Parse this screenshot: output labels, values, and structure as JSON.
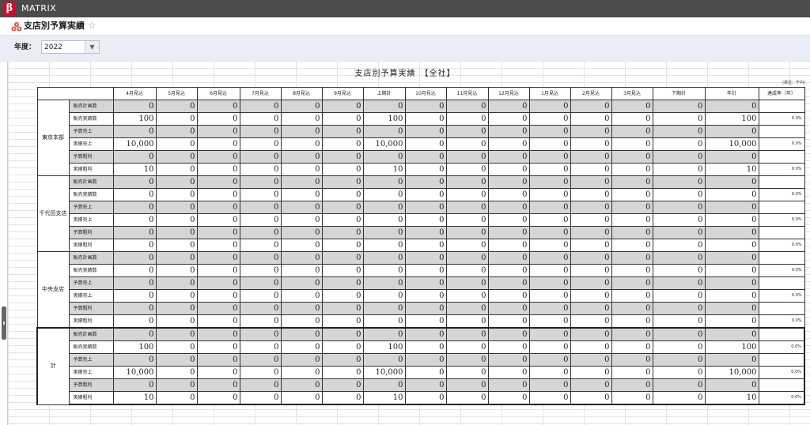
{
  "app": {
    "name": "MATRIX",
    "logo": "β"
  },
  "page": {
    "title": "支店別予算実績",
    "star": "☆",
    "icon": "tricolor-circles-icon"
  },
  "filter": {
    "year_label": "年度：",
    "year_value": "2022"
  },
  "report": {
    "title": "支店別予算実績　【全社】",
    "unit": "(単位：千円)",
    "columns": [
      "4月見込",
      "5月見込",
      "6月見込",
      "7月見込",
      "8月見込",
      "9月見込",
      "上期計",
      "10月見込",
      "11月見込",
      "12月見込",
      "1月見込",
      "2月見込",
      "3月見込",
      "下期計",
      "年計",
      "達成率（年）"
    ],
    "row_labels": [
      "販売計画数",
      "販売実績数",
      "予算売上",
      "実績売上",
      "予算粗利",
      "実績粗利"
    ],
    "groups": [
      {
        "name": "東京本部",
        "rows": [
          [
            "0",
            "0",
            "0",
            "0",
            "0",
            "0",
            "0",
            "0",
            "0",
            "0",
            "0",
            "0",
            "0",
            "0",
            "0",
            ""
          ],
          [
            "100",
            "0",
            "0",
            "0",
            "0",
            "0",
            "100",
            "0",
            "0",
            "0",
            "0",
            "0",
            "0",
            "0",
            "100",
            "0.0%"
          ],
          [
            "0",
            "0",
            "0",
            "0",
            "0",
            "0",
            "0",
            "0",
            "0",
            "0",
            "0",
            "0",
            "0",
            "0",
            "0",
            ""
          ],
          [
            "10,000",
            "0",
            "0",
            "0",
            "0",
            "0",
            "10,000",
            "0",
            "0",
            "0",
            "0",
            "0",
            "0",
            "0",
            "10,000",
            "0.0%"
          ],
          [
            "0",
            "0",
            "0",
            "0",
            "0",
            "0",
            "0",
            "0",
            "0",
            "0",
            "0",
            "0",
            "0",
            "0",
            "0",
            ""
          ],
          [
            "10",
            "0",
            "0",
            "0",
            "0",
            "0",
            "10",
            "0",
            "0",
            "0",
            "0",
            "0",
            "0",
            "0",
            "10",
            "0.0%"
          ]
        ]
      },
      {
        "name": "千代田支店",
        "rows": [
          [
            "0",
            "0",
            "0",
            "0",
            "0",
            "0",
            "0",
            "0",
            "0",
            "0",
            "0",
            "0",
            "0",
            "0",
            "0",
            ""
          ],
          [
            "0",
            "0",
            "0",
            "0",
            "0",
            "0",
            "0",
            "0",
            "0",
            "0",
            "0",
            "0",
            "0",
            "0",
            "0",
            "0.0%"
          ],
          [
            "0",
            "0",
            "0",
            "0",
            "0",
            "0",
            "0",
            "0",
            "0",
            "0",
            "0",
            "0",
            "0",
            "0",
            "0",
            ""
          ],
          [
            "0",
            "0",
            "0",
            "0",
            "0",
            "0",
            "0",
            "0",
            "0",
            "0",
            "0",
            "0",
            "0",
            "0",
            "0",
            "0.0%"
          ],
          [
            "0",
            "0",
            "0",
            "0",
            "0",
            "0",
            "0",
            "0",
            "0",
            "0",
            "0",
            "0",
            "0",
            "0",
            "0",
            ""
          ],
          [
            "0",
            "0",
            "0",
            "0",
            "0",
            "0",
            "0",
            "0",
            "0",
            "0",
            "0",
            "0",
            "0",
            "0",
            "0",
            "0.0%"
          ]
        ]
      },
      {
        "name": "中央支店",
        "rows": [
          [
            "0",
            "0",
            "0",
            "0",
            "0",
            "0",
            "0",
            "0",
            "0",
            "0",
            "0",
            "0",
            "0",
            "0",
            "0",
            ""
          ],
          [
            "0",
            "0",
            "0",
            "0",
            "0",
            "0",
            "0",
            "0",
            "0",
            "0",
            "0",
            "0",
            "0",
            "0",
            "0",
            "0.0%"
          ],
          [
            "0",
            "0",
            "0",
            "0",
            "0",
            "0",
            "0",
            "0",
            "0",
            "0",
            "0",
            "0",
            "0",
            "0",
            "0",
            ""
          ],
          [
            "0",
            "0",
            "0",
            "0",
            "0",
            "0",
            "0",
            "0",
            "0",
            "0",
            "0",
            "0",
            "0",
            "0",
            "0",
            "0.0%"
          ],
          [
            "0",
            "0",
            "0",
            "0",
            "0",
            "0",
            "0",
            "0",
            "0",
            "0",
            "0",
            "0",
            "0",
            "0",
            "0",
            ""
          ],
          [
            "0",
            "0",
            "0",
            "0",
            "0",
            "0",
            "0",
            "0",
            "0",
            "0",
            "0",
            "0",
            "0",
            "0",
            "0",
            "0.0%"
          ]
        ]
      },
      {
        "name": "計",
        "rows": [
          [
            "0",
            "0",
            "0",
            "0",
            "0",
            "0",
            "0",
            "0",
            "0",
            "0",
            "0",
            "0",
            "0",
            "0",
            "0",
            ""
          ],
          [
            "100",
            "0",
            "0",
            "0",
            "0",
            "0",
            "100",
            "0",
            "0",
            "0",
            "0",
            "0",
            "0",
            "0",
            "100",
            "0.0%"
          ],
          [
            "0",
            "0",
            "0",
            "0",
            "0",
            "0",
            "0",
            "0",
            "0",
            "0",
            "0",
            "0",
            "0",
            "0",
            "0",
            ""
          ],
          [
            "10,000",
            "0",
            "0",
            "0",
            "0",
            "0",
            "10,000",
            "0",
            "0",
            "0",
            "0",
            "0",
            "0",
            "0",
            "10,000",
            "0.0%"
          ],
          [
            "0",
            "0",
            "0",
            "0",
            "0",
            "0",
            "0",
            "0",
            "0",
            "0",
            "0",
            "0",
            "0",
            "0",
            "0",
            ""
          ],
          [
            "10",
            "0",
            "0",
            "0",
            "0",
            "0",
            "10",
            "0",
            "0",
            "0",
            "0",
            "0",
            "0",
            "0",
            "10",
            "0.0%"
          ]
        ]
      }
    ]
  }
}
